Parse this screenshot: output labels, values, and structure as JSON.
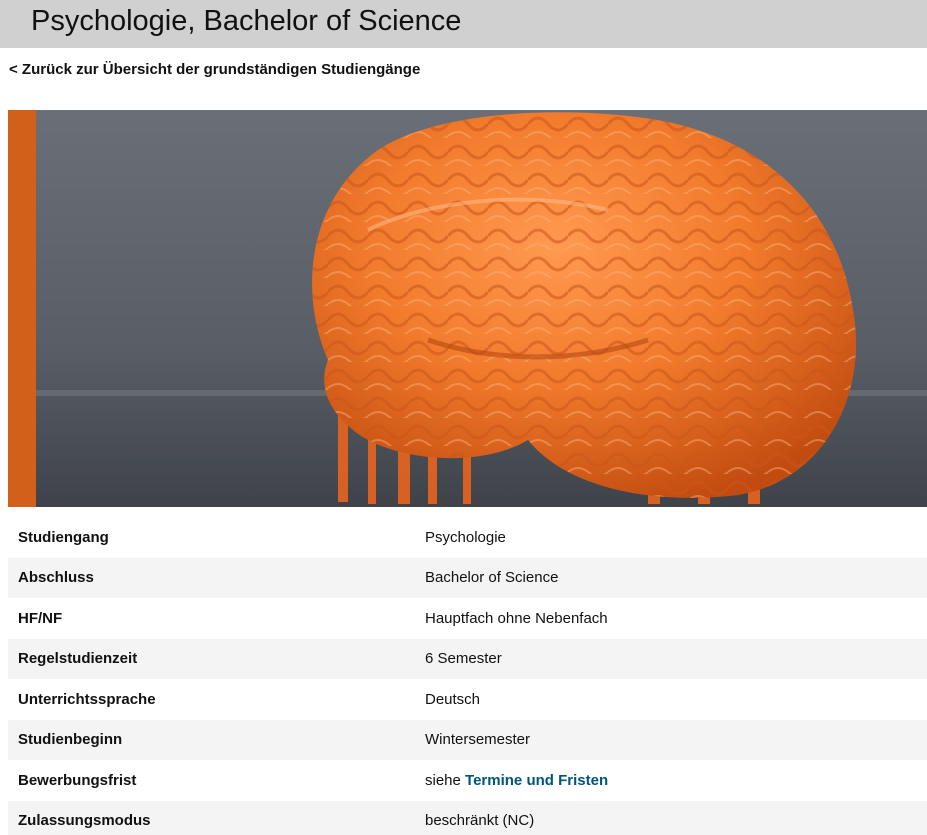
{
  "header": {
    "title": "Psychologie, Bachelor of Science"
  },
  "nav": {
    "back_link": "< Zurück zur Übersicht der grundständigen Studiengänge"
  },
  "hero": {
    "image": "orange-3d-printed-brain",
    "accent_color": "#d2601a"
  },
  "details": {
    "rows": [
      {
        "label": "Studiengang",
        "value": "Psychologie"
      },
      {
        "label": "Abschluss",
        "value": "Bachelor of Science"
      },
      {
        "label": "HF/NF",
        "value": "Hauptfach ohne Nebenfach"
      },
      {
        "label": "Regelstudienzeit",
        "value": "6 Semester"
      },
      {
        "label": "Unterrichtssprache",
        "value": "Deutsch"
      },
      {
        "label": "Studienbeginn",
        "value": "Wintersemester"
      },
      {
        "label": "Bewerbungsfrist",
        "value_prefix": "siehe",
        "value_link": "Termine und Fristen"
      },
      {
        "label": "Zulassungsmodus",
        "value": "beschränkt (NC)"
      }
    ]
  },
  "colors": {
    "link": "#00557a",
    "title_bar": "#d0d0d1",
    "row_alt": "#f4f4f4"
  }
}
